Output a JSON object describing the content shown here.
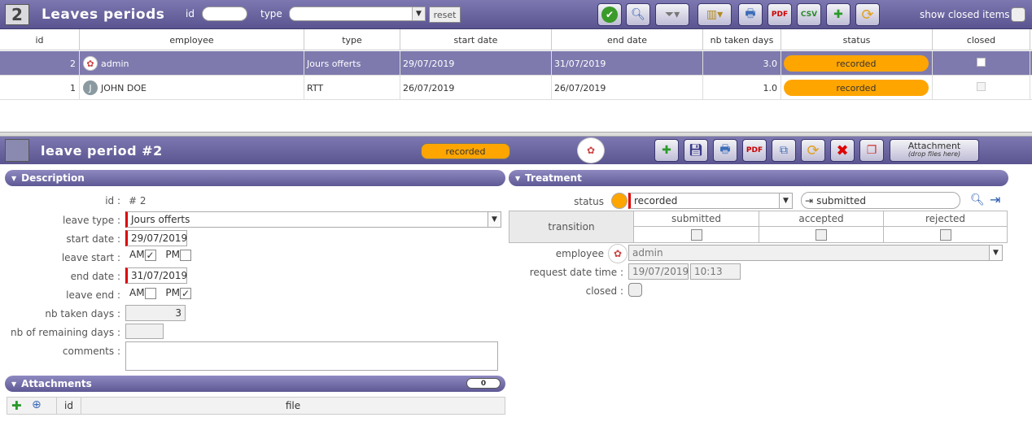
{
  "top": {
    "logo_num": "2",
    "title": "Leaves periods",
    "id_label": "id",
    "type_label": "type",
    "reset_label": "reset",
    "show_closed_label": "show closed items"
  },
  "grid": {
    "headers": [
      "id",
      "employee",
      "type",
      "start date",
      "end date",
      "nb taken days",
      "status",
      "closed"
    ],
    "rows": [
      {
        "id": "2",
        "employee": "admin",
        "type": "Jours offerts",
        "start": "29/07/2019",
        "end": "31/07/2019",
        "days": "3.0",
        "status": "recorded"
      },
      {
        "id": "1",
        "employee": "JOHN DOE",
        "type": "RTT",
        "start": "26/07/2019",
        "end": "26/07/2019",
        "days": "1.0",
        "status": "recorded"
      }
    ]
  },
  "detail": {
    "title": "leave period  #2",
    "status_badge": "recorded",
    "attachment_label": "Attachment",
    "attachment_sub": "(drop files here)"
  },
  "description": {
    "head": "Description",
    "id_label": "id :",
    "id_value": "#  2",
    "leave_type_label": "leave type :",
    "leave_type_value": "Jours offerts",
    "start_date_label": "start date :",
    "start_date_value": "29/07/2019",
    "leave_start_label": "leave start :",
    "am": "AM",
    "pm": "PM",
    "end_date_label": "end date :",
    "end_date_value": "31/07/2019",
    "leave_end_label": "leave end :",
    "nb_taken_label": "nb taken days :",
    "nb_taken_value": "3",
    "nb_remaining_label": "nb of remaining days :",
    "comments_label": "comments :"
  },
  "attachments": {
    "head": "Attachments",
    "count": "0",
    "col_id": "id",
    "col_file": "file"
  },
  "treatment": {
    "head": "Treatment",
    "status_label": "status",
    "status_value": "recorded",
    "next_status": "submitted",
    "transition_label": "transition",
    "cols": [
      "submitted",
      "accepted",
      "rejected"
    ],
    "employee_label": "employee",
    "employee_value": "admin",
    "request_label": "request date time :",
    "request_date": "19/07/2019",
    "request_time": "10:13",
    "closed_label": "closed :"
  },
  "colors": {
    "accent": "#6a65a0",
    "status": "#ffa500"
  }
}
